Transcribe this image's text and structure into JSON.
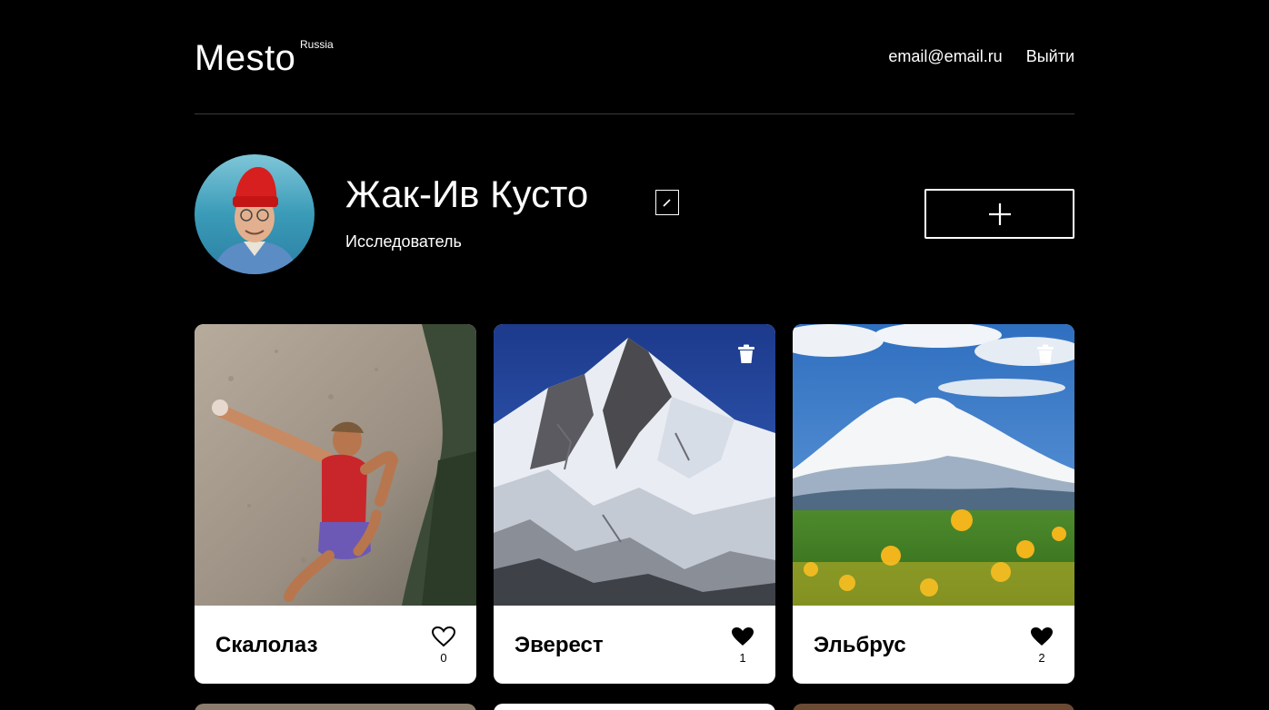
{
  "header": {
    "logo": "Mesto",
    "logo_sup": "Russia",
    "email": "email@email.ru",
    "logout": "Выйти"
  },
  "profile": {
    "name": "Жак-Ив Кусто",
    "job": "Исследователь",
    "edit_icon": "pencil-icon",
    "add_icon": "plus-icon"
  },
  "cards": [
    {
      "title": "Скалолаз",
      "likes": "0",
      "liked": false,
      "deletable": false
    },
    {
      "title": "Эверест",
      "likes": "1",
      "liked": true,
      "deletable": true
    },
    {
      "title": "Эльбрус",
      "likes": "2",
      "liked": true,
      "deletable": true
    }
  ],
  "colors": {
    "background": "#000000",
    "card": "#ffffff",
    "divider": "#545454"
  }
}
